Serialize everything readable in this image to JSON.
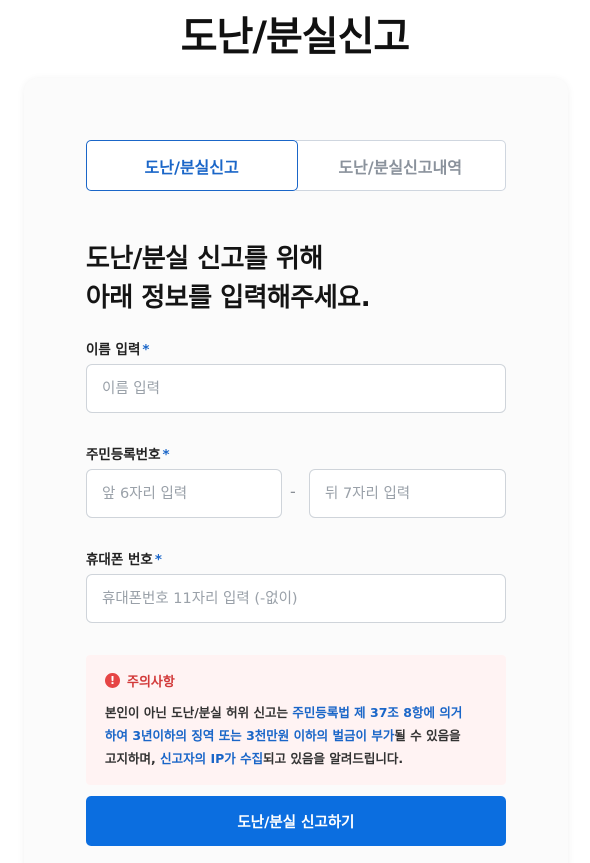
{
  "page": {
    "title": "도난/분실신고"
  },
  "tabs": [
    {
      "label": "도난/분실신고",
      "active": true
    },
    {
      "label": "도난/분실신고내역",
      "active": false
    }
  ],
  "heading": {
    "line1": "도난/분실 신고를 위해",
    "line2": "아래 정보를 입력해주세요."
  },
  "form": {
    "required_mark": "*",
    "name": {
      "label": "이름 입력",
      "placeholder": "이름 입력",
      "value": ""
    },
    "rrn": {
      "label": "주민등록번호",
      "front_placeholder": "앞 6자리 입력",
      "separator": "-",
      "back_placeholder": "뒤 7자리 입력"
    },
    "phone": {
      "label": "휴대폰 번호",
      "placeholder": "휴대폰번호 11자리 입력 (-없이)"
    }
  },
  "notice": {
    "icon": "exclamation-icon",
    "title": "주의사항",
    "line1": [
      "본인이 아닌 도난/분실 허위 신고는 ",
      "주민등록법 제 37조 8항에 의거"
    ],
    "line2": [
      "하여 3년이하의 징역 또는 3천만원 이하의 벌금이 부가",
      "될 수 있음을"
    ],
    "line3": [
      "고지하며, ",
      "신고자의 IP가 수집",
      "되고 있음을 알려드립니다."
    ]
  },
  "submit": {
    "label": "도난/분실 신고하기"
  },
  "colors": {
    "accent": "#1a66c8",
    "button": "#0b6ee0",
    "warning": "#e64545",
    "notice_bg": "#fff3f3"
  }
}
